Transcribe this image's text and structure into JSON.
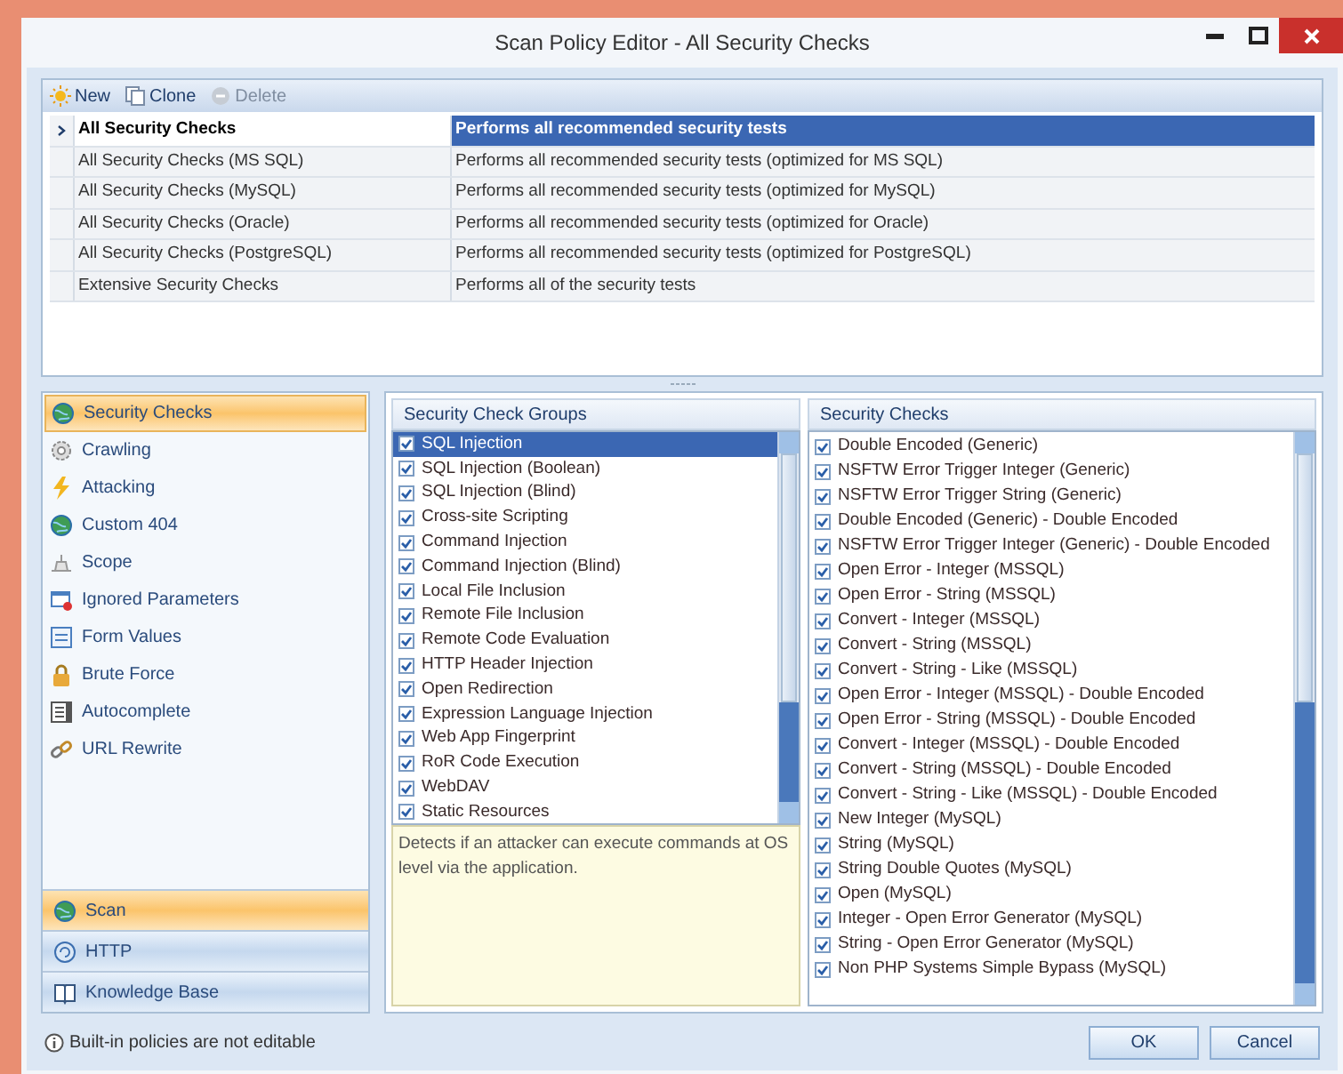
{
  "window": {
    "title": "Scan Policy Editor - All Security Checks"
  },
  "toolbar": [
    {
      "label": "New",
      "kind": "new",
      "disabled": false
    },
    {
      "label": "Clone",
      "kind": "clone",
      "disabled": false
    },
    {
      "label": "Delete",
      "kind": "delete",
      "disabled": true
    }
  ],
  "policies": [
    {
      "name": "All Security Checks",
      "description": "Performs all recommended security tests",
      "selected": true
    },
    {
      "name": "All Security Checks (MS SQL)",
      "description": "Performs all recommended security tests (optimized for MS SQL)",
      "selected": false
    },
    {
      "name": "All Security Checks (MySQL)",
      "description": "Performs all recommended security tests (optimized for MySQL)",
      "selected": false
    },
    {
      "name": "All Security Checks (Oracle)",
      "description": "Performs all recommended security tests (optimized for Oracle)",
      "selected": false
    },
    {
      "name": "All Security Checks (PostgreSQL)",
      "description": "Performs all recommended security tests (optimized for PostgreSQL)",
      "selected": false
    },
    {
      "name": "Extensive Security Checks",
      "description": "Performs all of the security tests",
      "selected": false
    }
  ],
  "nav": [
    {
      "label": "Security Checks",
      "kind": "globe",
      "selected": true
    },
    {
      "label": "Crawling",
      "kind": "gear",
      "selected": false
    },
    {
      "label": "Attacking",
      "kind": "bolt",
      "selected": false
    },
    {
      "label": "Custom 404",
      "kind": "globe",
      "selected": false
    },
    {
      "label": "Scope",
      "kind": "scope",
      "selected": false
    },
    {
      "label": "Ignored Parameters",
      "kind": "window",
      "selected": false
    },
    {
      "label": "Form Values",
      "kind": "form",
      "selected": false
    },
    {
      "label": "Brute Force",
      "kind": "lock",
      "selected": false
    },
    {
      "label": "Autocomplete",
      "kind": "list",
      "selected": false
    },
    {
      "label": "URL Rewrite",
      "kind": "link",
      "selected": false
    }
  ],
  "sections": [
    {
      "label": "Scan",
      "kind": "globe",
      "selected": true
    },
    {
      "label": "HTTP",
      "kind": "refresh",
      "selected": false
    },
    {
      "label": "Knowledge Base",
      "kind": "book",
      "selected": false
    }
  ],
  "groups": {
    "title": "Security Check Groups",
    "items": [
      {
        "label": "SQL Injection",
        "checked": true,
        "selected": true
      },
      {
        "label": "SQL Injection (Boolean)",
        "checked": true,
        "selected": false
      },
      {
        "label": "SQL Injection (Blind)",
        "checked": true,
        "selected": false
      },
      {
        "label": "Cross-site Scripting",
        "checked": true,
        "selected": false
      },
      {
        "label": "Command Injection",
        "checked": true,
        "selected": false
      },
      {
        "label": "Command Injection (Blind)",
        "checked": true,
        "selected": false
      },
      {
        "label": "Local File Inclusion",
        "checked": true,
        "selected": false
      },
      {
        "label": "Remote File Inclusion",
        "checked": true,
        "selected": false
      },
      {
        "label": "Remote Code Evaluation",
        "checked": true,
        "selected": false
      },
      {
        "label": "HTTP Header Injection",
        "checked": true,
        "selected": false
      },
      {
        "label": "Open Redirection",
        "checked": true,
        "selected": false
      },
      {
        "label": "Expression Language Injection",
        "checked": true,
        "selected": false
      },
      {
        "label": "Web App Fingerprint",
        "checked": true,
        "selected": false
      },
      {
        "label": "RoR Code Execution",
        "checked": true,
        "selected": false
      },
      {
        "label": "WebDAV",
        "checked": true,
        "selected": false
      },
      {
        "label": "Static Resources",
        "checked": true,
        "selected": false
      }
    ],
    "description": "Detects if an attacker can execute commands at OS level via the application."
  },
  "checks": {
    "title": "Security Checks",
    "items": [
      {
        "label": "Double Encoded (Generic)",
        "checked": true
      },
      {
        "label": "NSFTW Error Trigger Integer (Generic)",
        "checked": true
      },
      {
        "label": "NSFTW  Error Trigger String (Generic)",
        "checked": true
      },
      {
        "label": "Double Encoded (Generic) - Double Encoded",
        "checked": true
      },
      {
        "label": "NSFTW Error Trigger Integer (Generic) - Double Encoded",
        "checked": true
      },
      {
        "label": "Open Error - Integer (MSSQL)",
        "checked": true
      },
      {
        "label": "Open Error - String (MSSQL)",
        "checked": true
      },
      {
        "label": "Convert - Integer (MSSQL)",
        "checked": true
      },
      {
        "label": "Convert - String (MSSQL)",
        "checked": true
      },
      {
        "label": "Convert - String - Like (MSSQL)",
        "checked": true
      },
      {
        "label": "Open Error - Integer (MSSQL) - Double Encoded",
        "checked": true
      },
      {
        "label": "Open Error - String (MSSQL) - Double Encoded",
        "checked": true
      },
      {
        "label": "Convert - Integer (MSSQL) - Double Encoded",
        "checked": true
      },
      {
        "label": "Convert - String (MSSQL) - Double Encoded",
        "checked": true
      },
      {
        "label": "Convert - String - Like (MSSQL) - Double Encoded",
        "checked": true
      },
      {
        "label": "New Integer (MySQL)",
        "checked": true
      },
      {
        "label": "String (MySQL)",
        "checked": true
      },
      {
        "label": "String Double Quotes (MySQL)",
        "checked": true
      },
      {
        "label": "Open (MySQL)",
        "checked": true
      },
      {
        "label": "Integer - Open Error Generator (MySQL)",
        "checked": true
      },
      {
        "label": "String - Open Error Generator (MySQL)",
        "checked": true
      },
      {
        "label": "Non PHP Systems Simple Bypass (MySQL)",
        "checked": true
      }
    ]
  },
  "footer_note": "Built-in policies are not editable",
  "buttons": [
    "OK",
    "Cancel"
  ]
}
